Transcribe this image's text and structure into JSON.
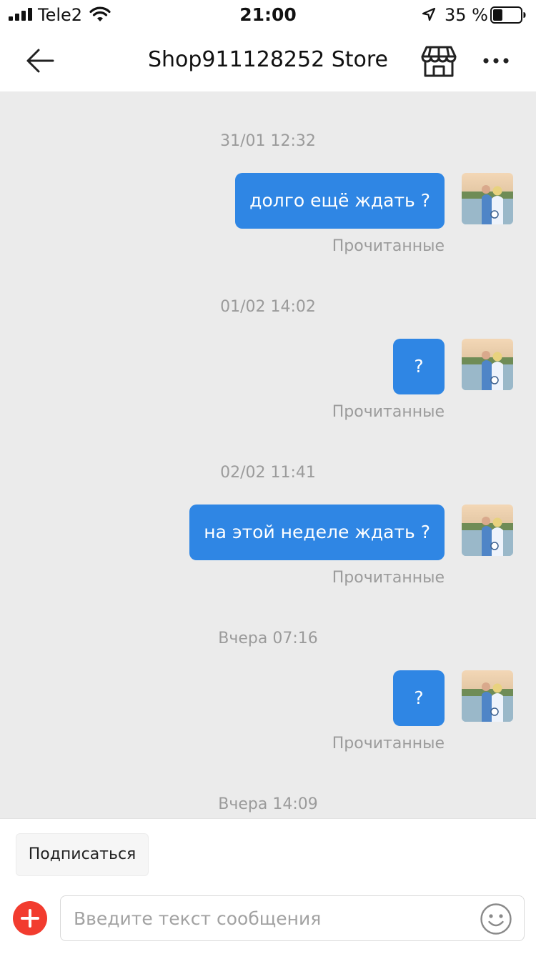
{
  "status_bar": {
    "carrier": "Tele2",
    "time": "21:00",
    "battery_percent": "35 %",
    "battery_level": 0.35,
    "icons": [
      "signal-bars-icon",
      "wifi-icon",
      "location-arrow-icon",
      "battery-icon"
    ]
  },
  "nav": {
    "title": "Shop911128252 Store",
    "icons": [
      "back-arrow-icon",
      "store-icon",
      "more-icon"
    ]
  },
  "messages": [
    {
      "timestamp": "31/01 12:32",
      "text": "долго ещё ждать ?",
      "status": "Прочитанные"
    },
    {
      "timestamp": "01/02 14:02",
      "text": "?",
      "status": "Прочитанные"
    },
    {
      "timestamp": "02/02 11:41",
      "text": "на этой неделе ждать ?",
      "status": "Прочитанные"
    },
    {
      "timestamp": "Вчера 07:16",
      "text": "?",
      "status": "Прочитанные"
    },
    {
      "timestamp": "Вчера 14:09"
    }
  ],
  "bottom": {
    "subscribe_label": "Подписаться",
    "input_placeholder": "Введите текст сообщения",
    "input_value": "",
    "icons": [
      "plus-icon",
      "emoji-icon"
    ]
  },
  "colors": {
    "bubble": "#2f86e4",
    "chat_background": "#ebebeb",
    "plus_button": "#f23c2f",
    "muted_text": "#9b9b9b"
  }
}
